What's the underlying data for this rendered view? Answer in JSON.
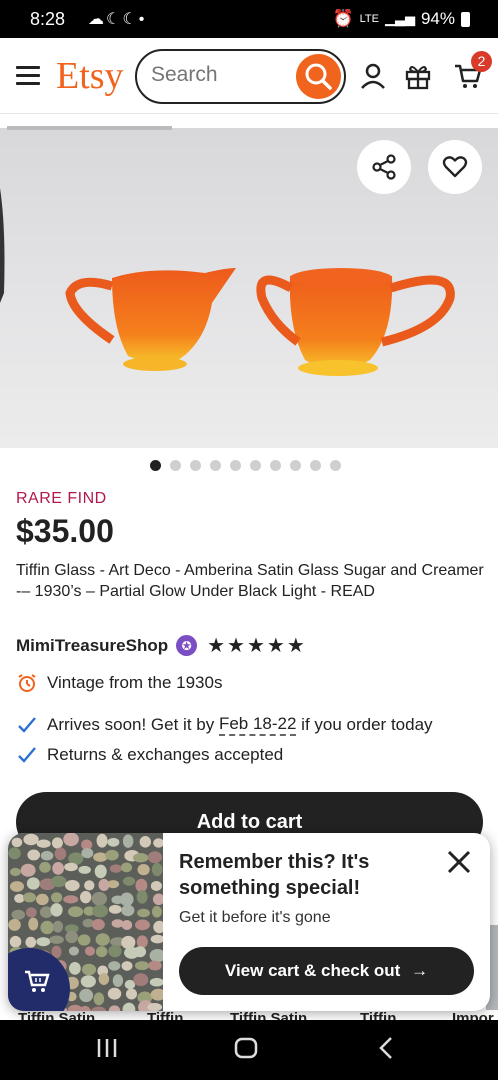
{
  "status_bar": {
    "time": "8:28",
    "network": "LTE",
    "battery": "94%"
  },
  "header": {
    "logo": "Etsy",
    "search_placeholder": "Search",
    "cart_count": "2"
  },
  "carousel": {
    "image_count": 10,
    "active_index": 0
  },
  "listing": {
    "badge": "RARE FIND",
    "price": "$35.00",
    "title": "Tiffin Glass - Art Deco - Amberina Satin Glass Sugar and Creamer -– 1930’s – Partial Glow Under Black Light - READ",
    "shop_name": "MimiTreasureShop",
    "rating_stars": "★★★★★",
    "vintage": "Vintage from the 1930s",
    "arrival_prefix": "Arrives soon! Get it by ",
    "arrival_dates": "Feb 18-22",
    "arrival_suffix": " if you order today",
    "returns": "Returns & exchanges accepted",
    "add_to_cart": "Add to cart"
  },
  "recommendations": {
    "labels": [
      "Tiffin Satin",
      "Tiffin",
      "Tiffin Satin",
      "Tiffin",
      "Impor"
    ]
  },
  "popup": {
    "title": "Remember this? It's something special!",
    "subtitle": "Get it before it's gone",
    "checkout_label": "View cart & check out",
    "checkout_arrow": "→"
  },
  "colors": {
    "brand": "#f1641e",
    "dark": "#222222",
    "rare": "#b2194b",
    "check": "#2b6fd1"
  }
}
